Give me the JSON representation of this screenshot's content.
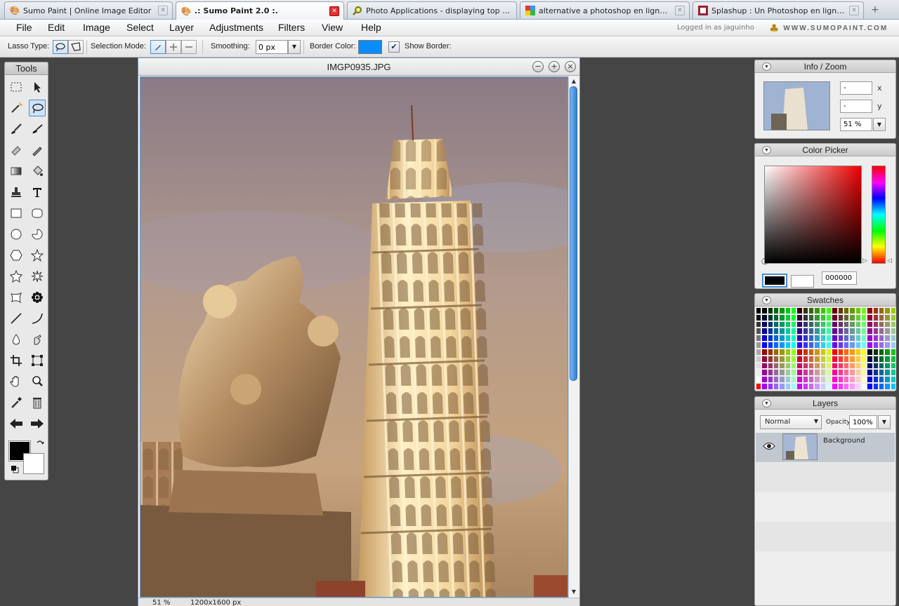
{
  "browser": {
    "tabs": [
      {
        "title": "Sumo Paint | Online Image Editor",
        "icon": "sumo-icon",
        "active": false
      },
      {
        "title": ".: Sumo Paint 2.0 :.",
        "icon": "sumo-icon",
        "active": true
      },
      {
        "title": "Photo Applications - displaying top ap...",
        "icon": "magnifier-icon",
        "active": false
      },
      {
        "title": "alternative a photoshop en ligne - Rec...",
        "icon": "google-icon",
        "active": false
      },
      {
        "title": "Splashup : Un Photoshop en ligne Grat...",
        "icon": "splashup-icon",
        "active": false
      }
    ],
    "new_tab": "+"
  },
  "menu": {
    "items": [
      "File",
      "Edit",
      "Image",
      "Select",
      "Layer",
      "Adjustments",
      "Filters",
      "View",
      "Help"
    ],
    "logged_in": "Logged in as jaguinho",
    "logo_text": "WWW.SUMOPAINT.COM"
  },
  "options": {
    "lasso_type_label": "Lasso Type:",
    "selection_mode_label": "Selection Mode:",
    "smoothing_label": "Smoothing:",
    "smoothing_value": "0 px",
    "border_color_label": "Border Color:",
    "border_color": "#0a8cff",
    "show_border_label": "Show Border:",
    "show_border_checked": true
  },
  "tools": {
    "title": "Tools",
    "foreground": "#000000",
    "background": "#ffffff"
  },
  "document": {
    "title": "IMGP0935.JPG",
    "zoom": "51 %",
    "size": "1200x1600 px"
  },
  "info_zoom": {
    "title": "Info / Zoom",
    "x_value": "-",
    "y_value": "-",
    "x_label": "x",
    "y_label": "y",
    "zoom": "51 %"
  },
  "color_picker": {
    "title": "Color Picker",
    "hex": "000000"
  },
  "swatches": {
    "title": "Swatches"
  },
  "layers": {
    "title": "Layers",
    "blend_mode": "Normal",
    "opacity_label": "Opacity:",
    "opacity": "100%",
    "items": [
      {
        "name": "Background",
        "visible": true
      }
    ]
  }
}
